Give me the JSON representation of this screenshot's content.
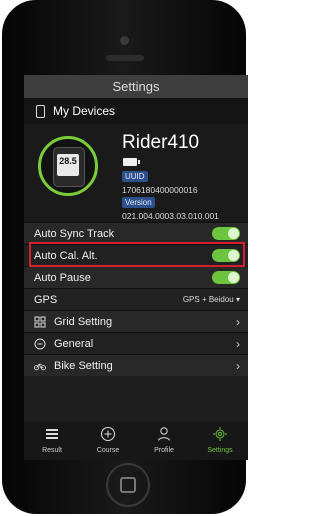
{
  "screen": {
    "title": "Settings",
    "my_devices": "My Devices",
    "device": {
      "name": "Rider410",
      "uuid_label": "UUID",
      "uuid_value": "1706180400000016",
      "version_label": "Version",
      "version_value": "021.004.0003.03.010.001",
      "display_value": "28.5"
    },
    "settings": [
      {
        "label": "Auto Sync Track",
        "type": "toggle",
        "value": true
      },
      {
        "label": "Auto Cal. Alt.",
        "type": "toggle",
        "value": true
      },
      {
        "label": "Auto Pause",
        "type": "toggle",
        "value": true
      },
      {
        "label": "GPS",
        "type": "select",
        "value": "GPS + Beidou"
      },
      {
        "label": "Grid Setting",
        "type": "nav",
        "icon": "grid-icon"
      },
      {
        "label": "General",
        "type": "nav",
        "icon": "minus-circle-icon"
      },
      {
        "label": "Bike Setting",
        "type": "nav",
        "icon": "bike-icon"
      }
    ],
    "tabs": [
      {
        "label": "Result",
        "icon": "list-icon"
      },
      {
        "label": "Course",
        "icon": "plus-circle-icon"
      },
      {
        "label": "Profile",
        "icon": "person-icon"
      },
      {
        "label": "Settings",
        "icon": "gear-icon",
        "active": true
      }
    ]
  },
  "colors": {
    "accent_green": "#6dc53f",
    "highlight_red": "#d41f2c",
    "tag_blue": "#2d4f8c"
  }
}
